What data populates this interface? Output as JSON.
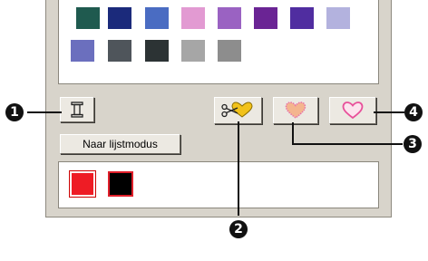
{
  "palette": {
    "row1": [
      "#1f5a4f",
      "#1b2a7b",
      "#4a6cc2",
      "#e29ad2",
      "#9a62c2",
      "#6a2494",
      "#502da0",
      "#b3b2de"
    ],
    "row2": [
      "#6b6fbe",
      "#4f555b",
      "#2c3334",
      "#a6a6a6",
      "#8d8d8d"
    ]
  },
  "toolbar": {
    "thread_icon": "spool-icon",
    "mode_button_label": "Naar lijstmodus",
    "scissors_heart_icon": "scissors-heart-icon",
    "heart_icon_1": "heart-icon",
    "heart_icon_2": "heart-outline-icon"
  },
  "current_colors": [
    "#ee1c25",
    "#000000"
  ],
  "callouts": {
    "c1": "1",
    "c2": "2",
    "c3": "3",
    "c4": "4"
  },
  "colors": {
    "selected_border": "#e01f2a",
    "heart_fill": "#f4b58e",
    "heart_outline": "#e870a8"
  }
}
